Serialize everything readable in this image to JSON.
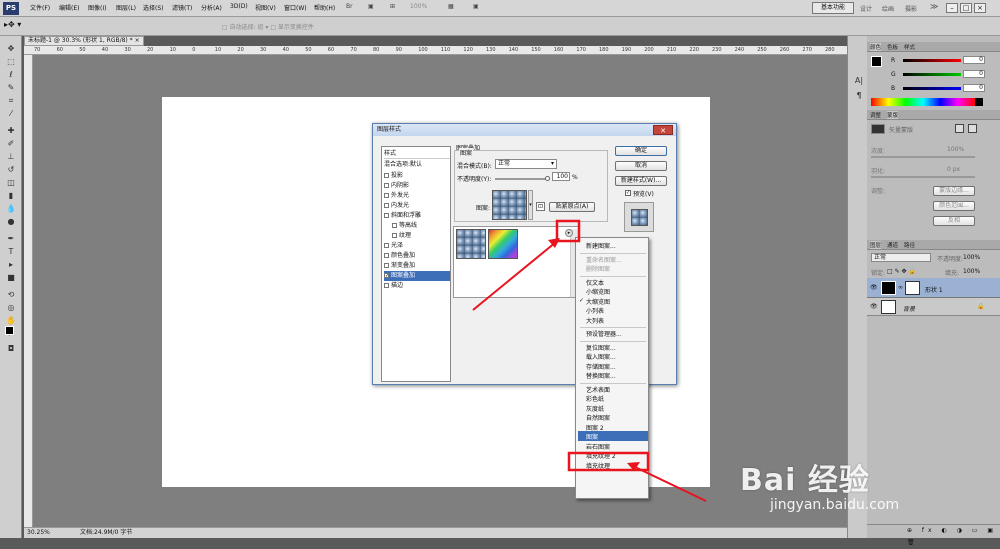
{
  "app": {
    "logo": "PS"
  },
  "menubar": {
    "items": [
      "文件(F)",
      "编辑(E)",
      "图像(I)",
      "图层(L)",
      "选择(S)",
      "滤镜(T)",
      "分析(A)",
      "3D(D)",
      "视图(V)",
      "窗口(W)",
      "帮助(H)"
    ],
    "zoom": "100%",
    "workspace_button": "基本功能",
    "workspace_links": [
      "设计",
      "绘画",
      "摄影"
    ],
    "more": "≫"
  },
  "options_bar": {
    "hint": "□ 自动选择: 组 ▾ □ 显示变换控件"
  },
  "document": {
    "tab_title": "未标题-1 @ 30.3% (形状 1, RGB/8) * ×",
    "ruler_numbers": [
      "70",
      "60",
      "50",
      "40",
      "30",
      "20",
      "10",
      "0",
      "10",
      "20",
      "30",
      "40",
      "50",
      "60",
      "70",
      "80",
      "90",
      "100",
      "110",
      "120",
      "130",
      "140",
      "150",
      "160",
      "170",
      "180",
      "190",
      "200",
      "210",
      "220",
      "230",
      "240",
      "250",
      "260",
      "270",
      "280"
    ],
    "status_zoom": "30.25%",
    "status_doc": "文档:24.9M/0 字节"
  },
  "dialog": {
    "title": "图层样式",
    "close": "✕",
    "styles_header": "样式",
    "blend_default": "混合选项:默认",
    "effects": [
      {
        "label": "投影",
        "checked": false,
        "sub": false
      },
      {
        "label": "内阴影",
        "checked": false,
        "sub": false
      },
      {
        "label": "外发光",
        "checked": false,
        "sub": false
      },
      {
        "label": "内发光",
        "checked": false,
        "sub": false
      },
      {
        "label": "斜面和浮雕",
        "checked": false,
        "sub": false
      },
      {
        "label": "等高线",
        "checked": false,
        "sub": true
      },
      {
        "label": "纹理",
        "checked": false,
        "sub": true
      },
      {
        "label": "光泽",
        "checked": false,
        "sub": false
      },
      {
        "label": "颜色叠加",
        "checked": false,
        "sub": false
      },
      {
        "label": "渐变叠加",
        "checked": false,
        "sub": false
      },
      {
        "label": "图案叠加",
        "checked": true,
        "sub": false
      },
      {
        "label": "描边",
        "checked": false,
        "sub": false
      }
    ],
    "section_title": "图案叠加",
    "group_title": "图案",
    "blend_mode_label": "混合模式(B):",
    "blend_mode_value": "正常",
    "opacity_label": "不透明度(Y):",
    "opacity_value": "100",
    "opacity_unit": "%",
    "pattern_label": "图案:",
    "snap_button": "贴紧原点(A)",
    "ok": "确定",
    "cancel": "取消",
    "new_style": "新建样式(W)...",
    "preview_label": "预览(V)",
    "preview_checked": true
  },
  "context_menu": {
    "items": [
      {
        "label": "新建图案...",
        "disabled": false,
        "checked": false
      },
      {
        "sep": true
      },
      {
        "label": "重命名图案...",
        "disabled": true,
        "checked": false
      },
      {
        "label": "删除图案",
        "disabled": true,
        "checked": false
      },
      {
        "sep": true
      },
      {
        "label": "仅文本",
        "disabled": false,
        "checked": false
      },
      {
        "label": "小缩览图",
        "disabled": false,
        "checked": false
      },
      {
        "label": "大缩览图",
        "disabled": false,
        "checked": true
      },
      {
        "label": "小列表",
        "disabled": false,
        "checked": false
      },
      {
        "label": "大列表",
        "disabled": false,
        "checked": false
      },
      {
        "sep": true
      },
      {
        "label": "预设管理器...",
        "disabled": false,
        "checked": false
      },
      {
        "sep": true
      },
      {
        "label": "复位图案...",
        "disabled": false,
        "checked": false
      },
      {
        "label": "载入图案...",
        "disabled": false,
        "checked": false
      },
      {
        "label": "存储图案...",
        "disabled": false,
        "checked": false
      },
      {
        "label": "替换图案...",
        "disabled": false,
        "checked": false
      },
      {
        "sep": true
      },
      {
        "label": "艺术表面",
        "disabled": false,
        "checked": false
      },
      {
        "label": "彩色纸",
        "disabled": false,
        "checked": false
      },
      {
        "label": "灰度纸",
        "disabled": false,
        "checked": false
      },
      {
        "label": "自然图案",
        "disabled": false,
        "checked": false
      },
      {
        "label": "图案 2",
        "disabled": false,
        "checked": false
      },
      {
        "label": "图案",
        "disabled": false,
        "checked": false,
        "highlight": true
      },
      {
        "label": "岩石图案",
        "disabled": false,
        "checked": false
      },
      {
        "label": "填充纹理 2",
        "disabled": false,
        "checked": false
      },
      {
        "label": "填充纹理",
        "disabled": false,
        "checked": false
      }
    ]
  },
  "color_panel": {
    "tabs": [
      "颜色",
      "色板",
      "样式"
    ],
    "labels": [
      "R",
      "G",
      "B"
    ],
    "values": [
      "0",
      "0",
      "0"
    ]
  },
  "adjust_panel": {
    "tabs": [
      "调整",
      "蒙版"
    ],
    "vector_mask": "矢量蒙版",
    "density_label": "浓度:",
    "density_value": "100%",
    "feather_label": "羽化:",
    "feather_value": "0 px",
    "refine_label": "调整:",
    "buttons": [
      "蒙版边缘...",
      "颜色范围...",
      "反相"
    ]
  },
  "layers_panel": {
    "tabs": [
      "图层",
      "通道",
      "路径"
    ],
    "mode": "正常",
    "opacity_label": "不透明度:",
    "opacity_value": "100%",
    "lock_label": "锁定:",
    "fill_label": "填充:",
    "fill_value": "100%",
    "layers": [
      {
        "name": "形状 1"
      },
      {
        "name": "背景"
      }
    ]
  },
  "watermark": {
    "main": "Bai 经验",
    "sub": "jingyan.baidu.com"
  },
  "colors": {
    "accent": "#3d6eb8",
    "annotation": "#e8141e"
  }
}
